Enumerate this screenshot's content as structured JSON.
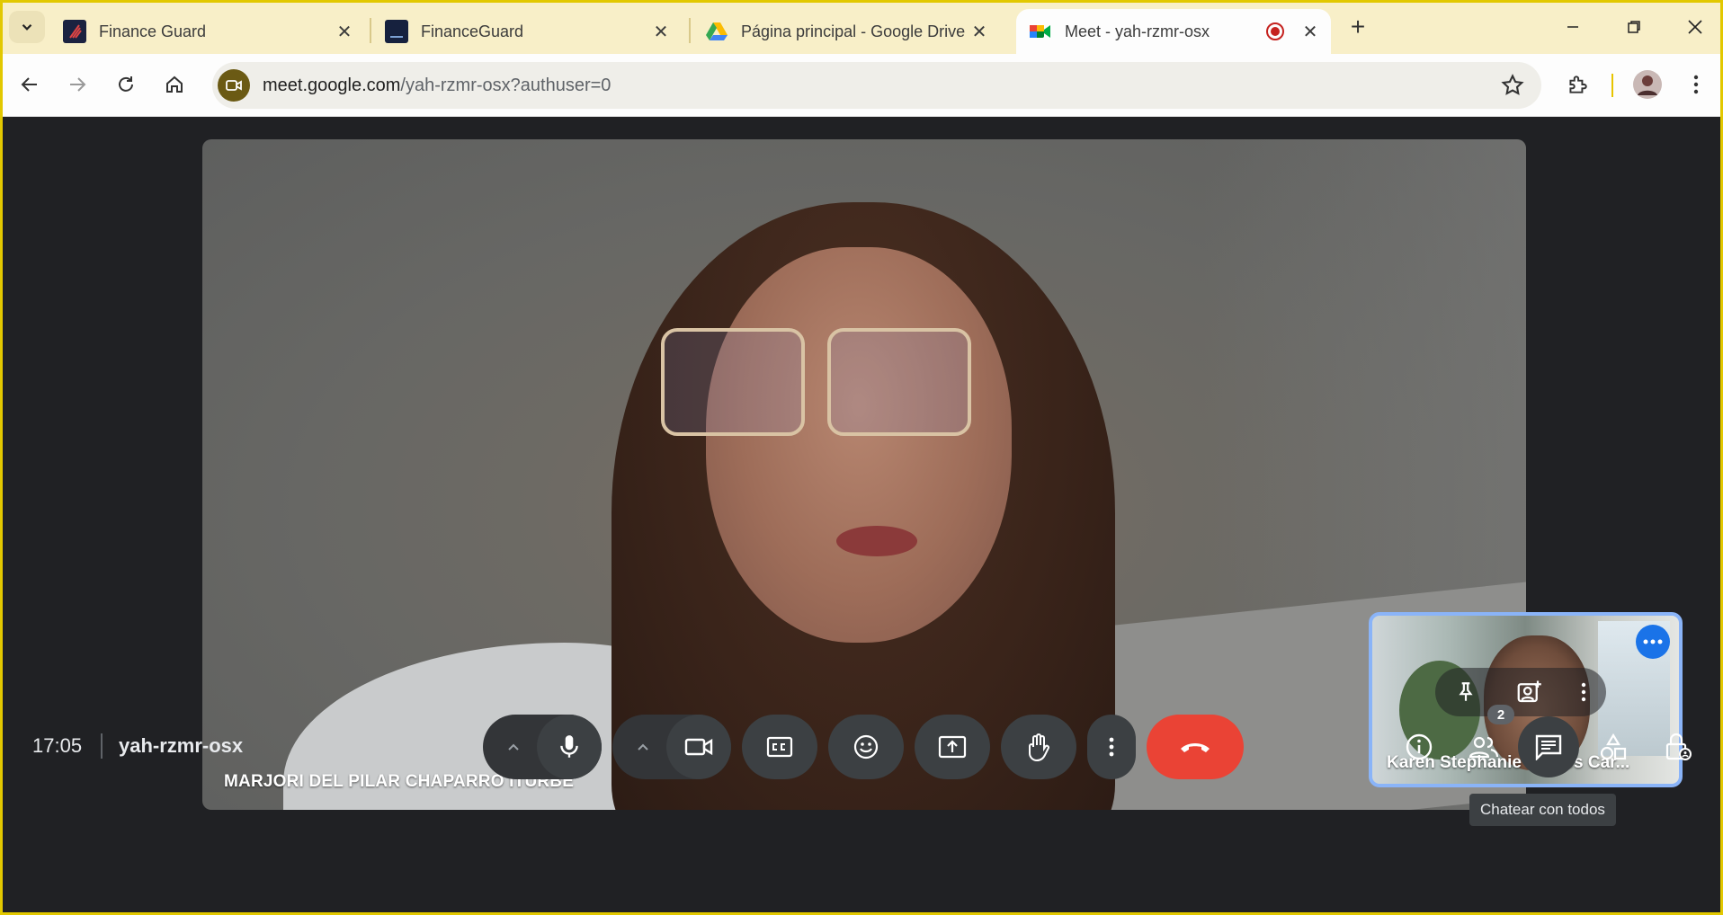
{
  "browser": {
    "tabs": [
      {
        "title": "Finance Guard"
      },
      {
        "title": "FinanceGuard"
      },
      {
        "title": "Página principal - Google Drive"
      },
      {
        "title": "Meet - yah-rzmr-osx"
      }
    ],
    "url": {
      "host": "meet.google.com",
      "path": "/yah-rzmr-osx?authuser=0"
    }
  },
  "meet": {
    "main_participant": "MARJORI DEL PILAR CHAPARRO ITURBE",
    "pip_participant": "Karen Stephanie Ramos Car...",
    "tooltip": "Chatear con todos",
    "clock": "17:05",
    "meeting_code": "yah-rzmr-osx",
    "participants_count": "2"
  },
  "colors": {
    "accent": "#1a73e8",
    "hangup": "#ea4335",
    "tab_strip": "#f8efc8",
    "window_border": "#e2c800"
  },
  "icons": [
    "tab-search-chevron-icon",
    "close-icon",
    "new-tab-icon",
    "minimize-icon",
    "restore-icon",
    "back-icon",
    "forward-icon",
    "reload-icon",
    "home-icon",
    "meet-site-icon",
    "bookmark-star-icon",
    "extensions-icon",
    "profile-avatar",
    "menu-dots-icon",
    "mic-icon",
    "camera-icon",
    "captions-icon",
    "emoji-icon",
    "present-icon",
    "raise-hand-icon",
    "more-options-icon",
    "hangup-icon",
    "info-icon",
    "people-icon",
    "chat-icon",
    "activities-icon",
    "host-controls-icon",
    "pin-icon",
    "add-frame-icon"
  ]
}
